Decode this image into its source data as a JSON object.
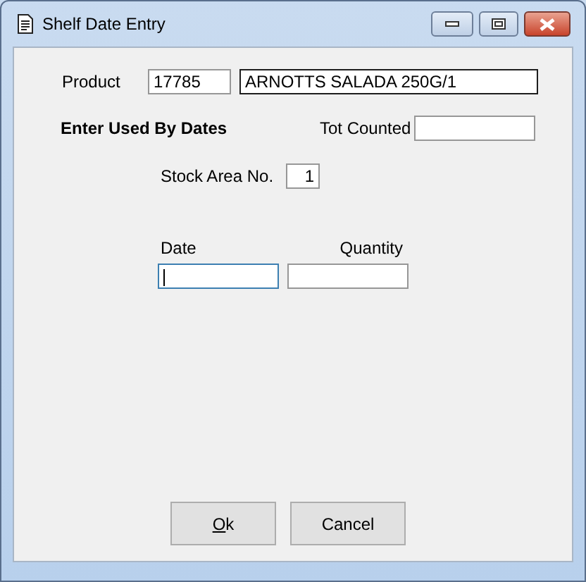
{
  "window": {
    "title": "Shelf Date Entry"
  },
  "product": {
    "label": "Product",
    "code": "17785",
    "description": "ARNOTTS SALADA 250G/1"
  },
  "section_heading": "Enter Used By Dates",
  "tot_counted": {
    "label": "Tot Counted"
  },
  "stock_area": {
    "label": "Stock Area No.",
    "value": "1"
  },
  "entry": {
    "date_label": "Date",
    "quantity_label": "Quantity",
    "date_focused": true
  },
  "buttons": [
    {
      "label": "Ok",
      "first_letter_underlined": true
    },
    {
      "label": "Cancel",
      "first_letter_underlined": false
    }
  ]
}
